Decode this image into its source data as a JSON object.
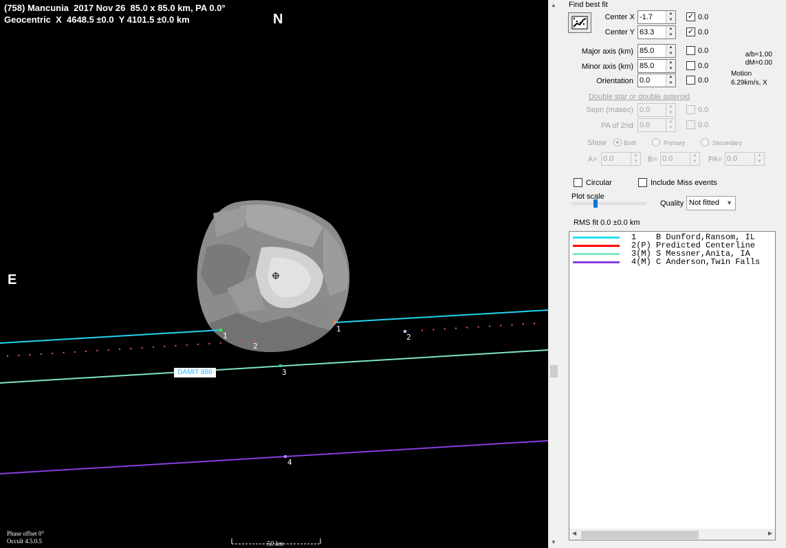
{
  "plot": {
    "title_line1": "(758) Mancunia  2017 Nov 26  85.0 x 85.0 km, PA 0.0°",
    "title_line2": "Geocentric  X  4648.5 ±0.0  Y 4101.5 ±0.0 km",
    "north_label": "N",
    "east_label": "E",
    "damit_label": "DAMIT 886",
    "phase_offset": "Phase offset 0°",
    "version": "Occult 4.5.0.5",
    "scale_label": "50 km",
    "chord_labels": [
      "1",
      "1",
      "2",
      "2",
      "3",
      "4"
    ],
    "colors": {
      "background": "#000000",
      "chord1": "#22d4f0",
      "chord2": "#ff5a5a",
      "chord3": "#7de8c2",
      "chord4": "#8a3ce0",
      "asteroid": "#8c8c8c"
    }
  },
  "panel": {
    "find_best_fit": "Find best fit",
    "center_x_label": "Center X",
    "center_x_value": "-1.7",
    "center_x_check": true,
    "center_x_rms": "0.0",
    "center_y_label": "Center Y",
    "center_y_value": "63.3",
    "center_y_check": true,
    "center_y_rms": "0.0",
    "major_label": "Major axis (km)",
    "major_value": "85.0",
    "major_rms": "0.0",
    "minor_label": "Minor axis (km)",
    "minor_value": "85.0",
    "minor_rms": "0.0",
    "orient_label": "Orientation",
    "orient_value": "0.0",
    "orient_rms": "0.0",
    "ab_ratio": "a/b=1.00",
    "dm": "dM=0.00",
    "motion_label": "Motion",
    "motion_value": "6.29km/s, X",
    "double_star_link": "Double star  or  double asteroid",
    "sepn_label": "Sepn (masec)",
    "sepn_value": "0.0",
    "sepn_rms": "0.0",
    "pa2_label": "PA of 2nd",
    "pa2_value": "0.0",
    "pa2_rms": "0.0",
    "show_label": "Show",
    "show_both": "Both",
    "show_primary": "Primary",
    "show_secondary": "Secondary",
    "a_label": "A=",
    "a_value": "0.0",
    "b_label": "B=",
    "b_value": "0.0",
    "pa_label": "PA=",
    "pa_value": "0.0",
    "circular_label": "Circular",
    "miss_label": "Include Miss events",
    "plot_scale_label": "Plot scale",
    "quality_label": "Quality",
    "quality_value": "Not fitted",
    "rms_fit": "RMS fit 0.0 ±0.0 km"
  },
  "legend": [
    {
      "num": "1   ",
      "text": " B Dunford,Ransom, IL",
      "color": "#22e0f0"
    },
    {
      "num": "2(P)",
      "text": " Predicted Centerline",
      "color": "#ff0000"
    },
    {
      "num": "3(M)",
      "text": " S Messner,Anita, IA",
      "color": "#7de8c2"
    },
    {
      "num": "4(M)",
      "text": " C Anderson,Twin Falls",
      "color": "#8a3ce0"
    }
  ]
}
